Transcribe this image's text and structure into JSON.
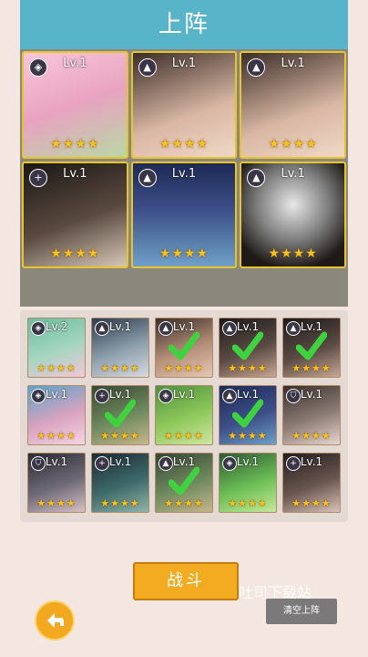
{
  "header": {
    "title": "上阵"
  },
  "team": [
    {
      "lv": "Lv.1",
      "role": "◈",
      "stars": "★★★★"
    },
    {
      "lv": "Lv.1",
      "role": "▲",
      "stars": "★★★★"
    },
    {
      "lv": "Lv.1",
      "role": "▲",
      "stars": "★★★★"
    },
    {
      "lv": "Lv.1",
      "role": "+",
      "stars": "★★★★"
    },
    {
      "lv": "Lv.1",
      "role": "▲",
      "stars": "★★★★"
    },
    {
      "lv": "Lv.1",
      "role": "▲",
      "stars": "★★★★"
    }
  ],
  "roster": [
    {
      "lv": "Lv.2",
      "role": "◈",
      "stars": "★★★★",
      "checked": false
    },
    {
      "lv": "Lv.1",
      "role": "▲",
      "stars": "★★★★",
      "checked": false
    },
    {
      "lv": "Lv.1",
      "role": "▲",
      "stars": "★★★★",
      "checked": true
    },
    {
      "lv": "Lv.1",
      "role": "▲",
      "stars": "★★★★",
      "checked": true
    },
    {
      "lv": "Lv.1",
      "role": "▲",
      "stars": "★★★★",
      "checked": true
    },
    {
      "lv": "Lv.1",
      "role": "◈",
      "stars": "★★★★",
      "checked": false
    },
    {
      "lv": "Lv.1",
      "role": "+",
      "stars": "★★★★",
      "checked": true
    },
    {
      "lv": "Lv.1",
      "role": "◈",
      "stars": "★★★★",
      "checked": false
    },
    {
      "lv": "Lv.1",
      "role": "▲",
      "stars": "★★★★",
      "checked": true
    },
    {
      "lv": "Lv.1",
      "role": "⛉",
      "stars": "★★★★",
      "checked": false
    },
    {
      "lv": "Lv.1",
      "role": "⛉",
      "stars": "★★★★",
      "checked": false
    },
    {
      "lv": "Lv.1",
      "role": "+",
      "stars": "★★★★",
      "checked": false
    },
    {
      "lv": "Lv.1",
      "role": "▲",
      "stars": "★★★★",
      "checked": true
    },
    {
      "lv": "Lv.1",
      "role": "◈",
      "stars": "★★★★",
      "checked": false
    },
    {
      "lv": "Lv.1",
      "role": "+",
      "stars": "★★★★",
      "checked": false
    }
  ],
  "buttons": {
    "fight": "战斗",
    "clear": "清空上阵"
  },
  "watermark": "吐司下载站"
}
